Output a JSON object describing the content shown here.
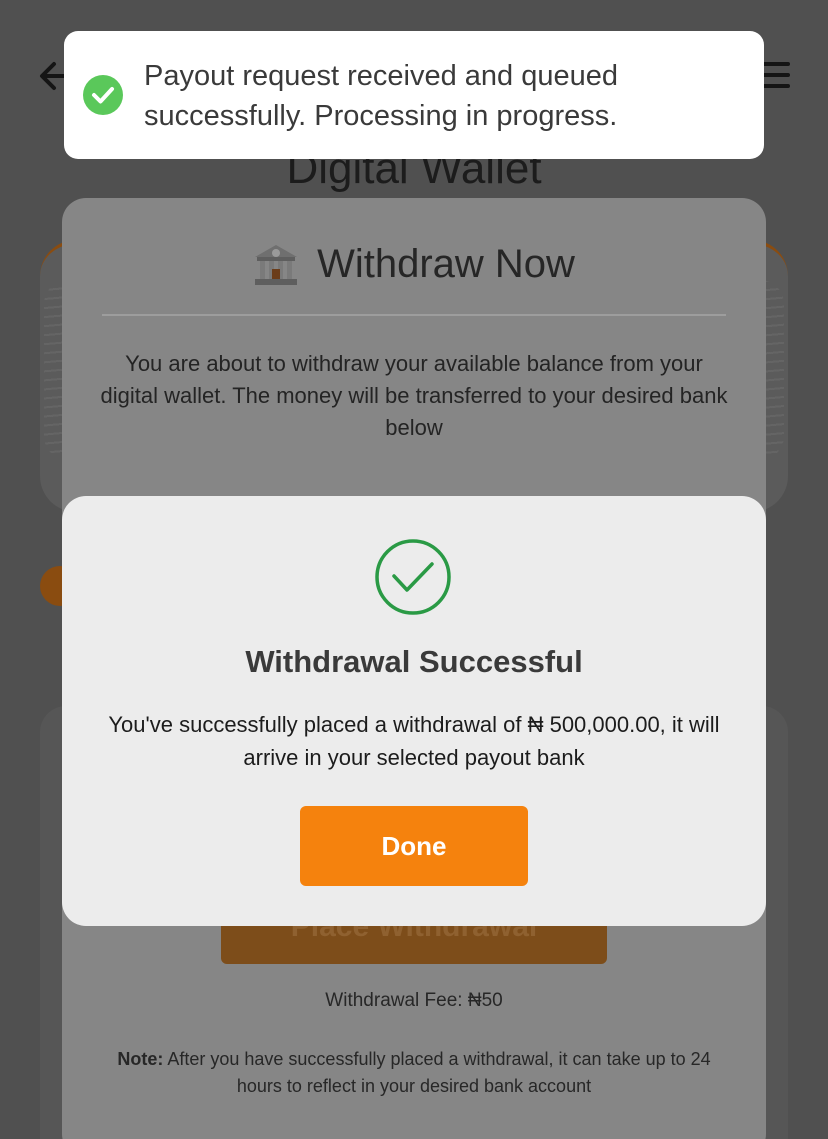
{
  "page": {
    "title": "Digital Wallet"
  },
  "withdraw_sheet": {
    "title": "Withdraw Now",
    "description": "You are about to withdraw your available balance from your digital wallet. The money will be transferred to your desired bank below",
    "place_button_label": "Place Withdrawal",
    "fee_text": "Withdrawal Fee: ₦50",
    "note_label": "Note:",
    "note_text": " After you have successfully placed a withdrawal, it can take up to 24 hours to reflect in your desired bank account"
  },
  "success_modal": {
    "title": "Withdrawal Successful",
    "message": "You've successfully placed a withdrawal of ₦ 500,000.00, it will arrive in your selected payout bank",
    "done_label": "Done"
  },
  "toast": {
    "message": "Payout request received and queued successfully. Processing in progress."
  },
  "colors": {
    "accent": "#f5820d",
    "success": "#2a9a45",
    "toast_success": "#5ac85a"
  }
}
